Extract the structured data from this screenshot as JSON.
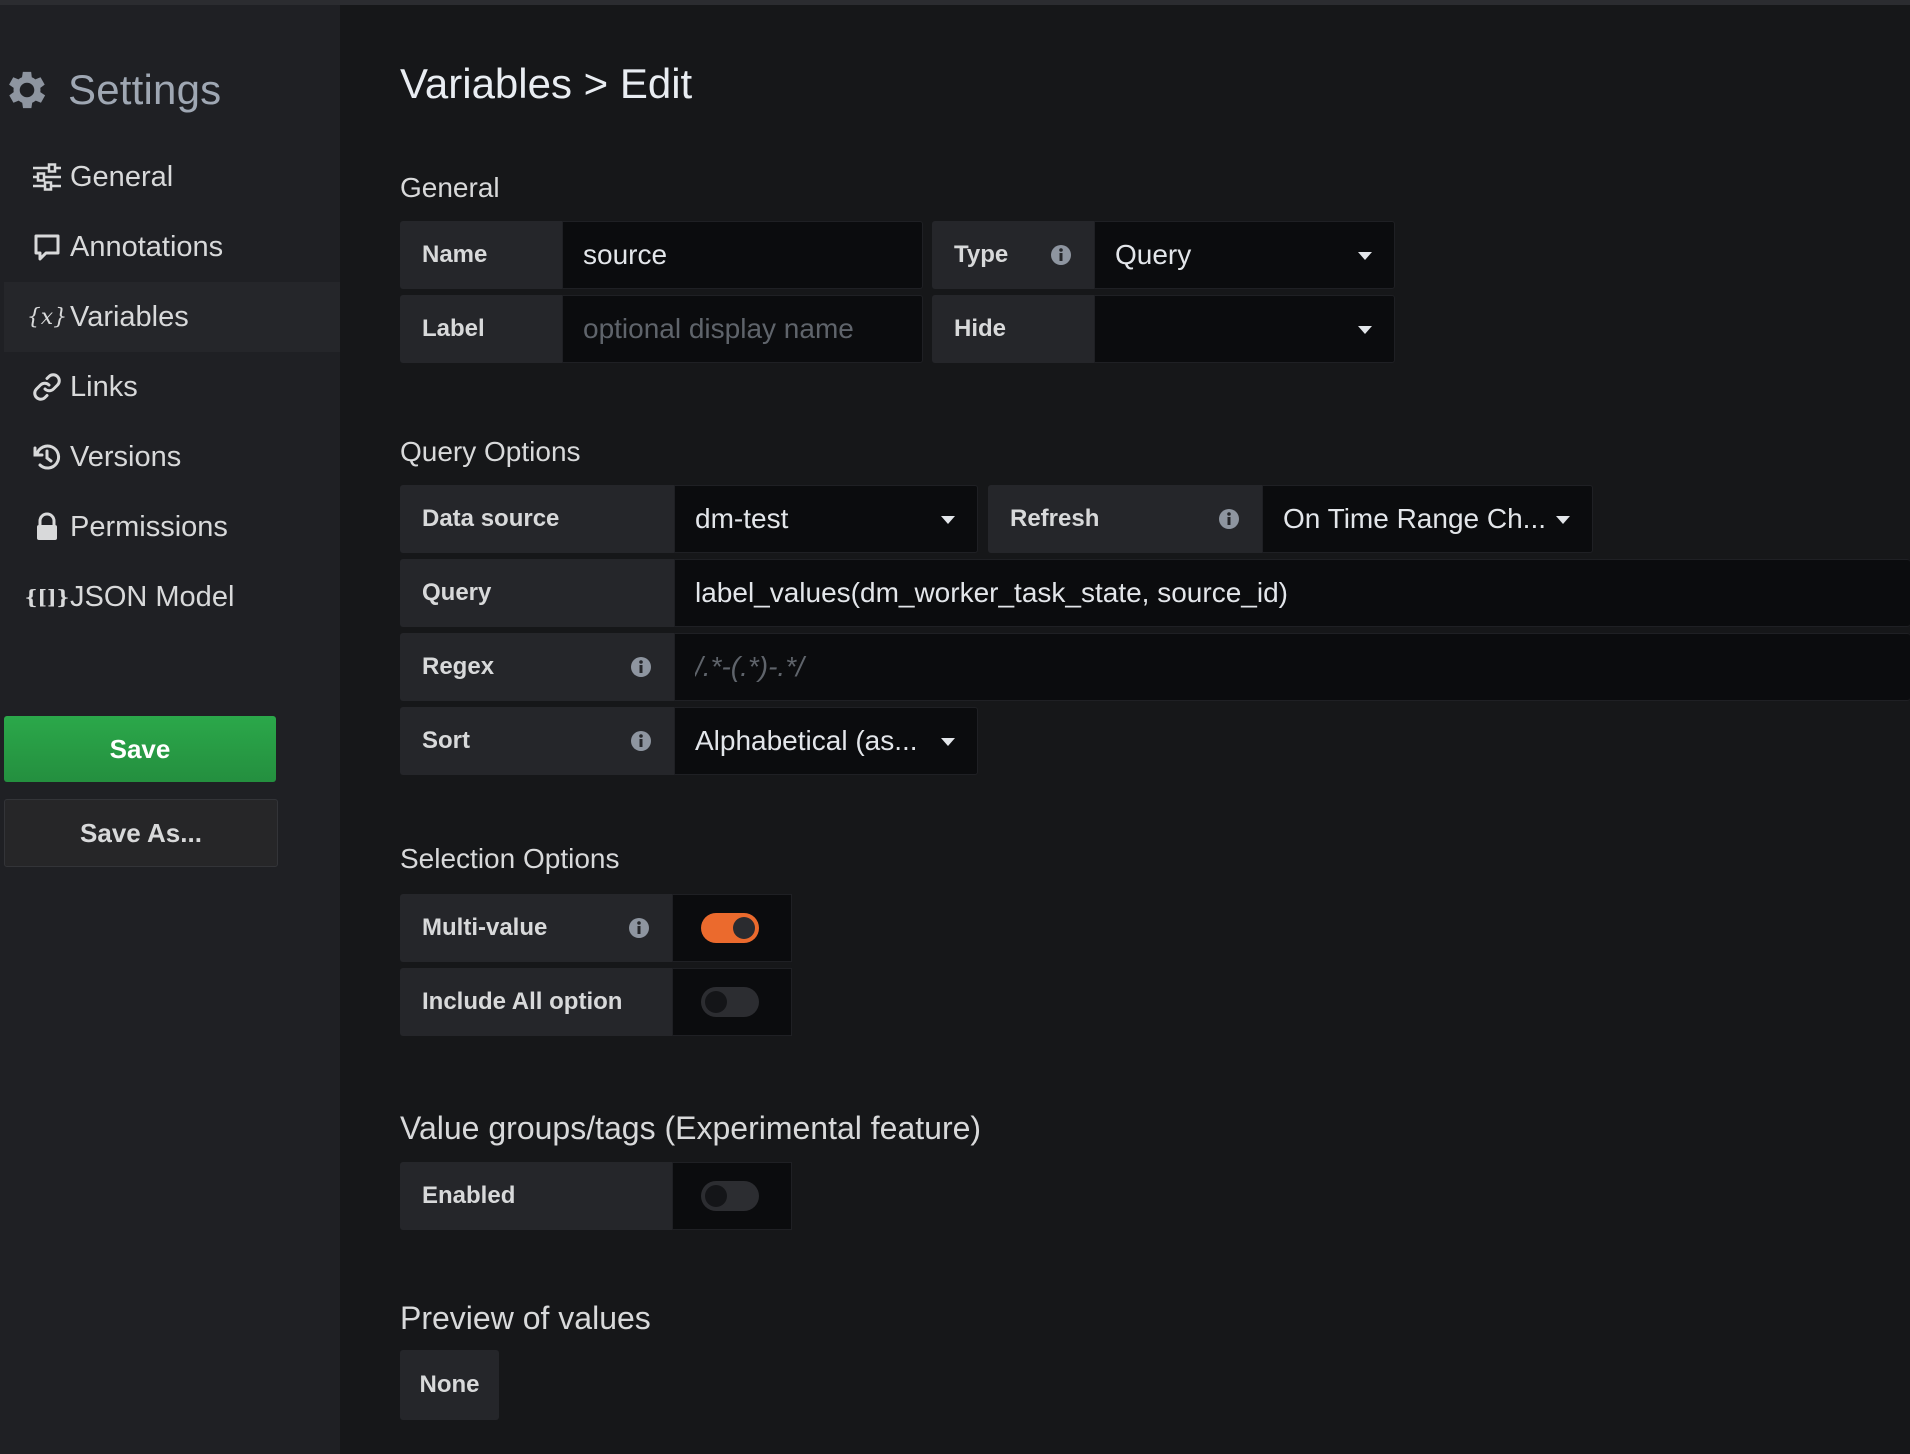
{
  "sidebar": {
    "title": "Settings",
    "items": [
      {
        "label": "General",
        "icon": "sliders-icon"
      },
      {
        "label": "Annotations",
        "icon": "comment-icon"
      },
      {
        "label": "Variables",
        "icon": "variable-icon",
        "glyph": "{x}"
      },
      {
        "label": "Links",
        "icon": "link-icon"
      },
      {
        "label": "Versions",
        "icon": "history-icon"
      },
      {
        "label": "Permissions",
        "icon": "lock-icon"
      },
      {
        "label": "JSON Model",
        "icon": "json-icon",
        "glyph": "{[]}"
      }
    ],
    "save_label": "Save",
    "save_as_label": "Save As..."
  },
  "page": {
    "title": "Variables > Edit"
  },
  "general": {
    "title": "General",
    "name_label": "Name",
    "name_value": "source",
    "type_label": "Type",
    "type_value": "Query",
    "label_label": "Label",
    "label_placeholder": "optional display name",
    "hide_label": "Hide",
    "hide_value": ""
  },
  "query_options": {
    "title": "Query Options",
    "datasource_label": "Data source",
    "datasource_value": "dm-test",
    "refresh_label": "Refresh",
    "refresh_value": "On Time Range Ch...",
    "query_label": "Query",
    "query_value": "label_values(dm_worker_task_state, source_id)",
    "regex_label": "Regex",
    "regex_placeholder": "/.*-(.*)-.*/",
    "sort_label": "Sort",
    "sort_value": "Alphabetical (as..."
  },
  "selection_options": {
    "title": "Selection Options",
    "multi_value_label": "Multi-value",
    "multi_value_on": true,
    "include_all_label": "Include All option",
    "include_all_on": false
  },
  "value_groups": {
    "title": "Value groups/tags (Experimental feature)",
    "enabled_label": "Enabled",
    "enabled_on": false
  },
  "preview": {
    "title": "Preview of values",
    "none_label": "None"
  },
  "colors": {
    "save_green": "#299c46",
    "toggle_on": "#eb6a2d",
    "background": "#161719",
    "sidebar_bg": "#1f2024"
  }
}
